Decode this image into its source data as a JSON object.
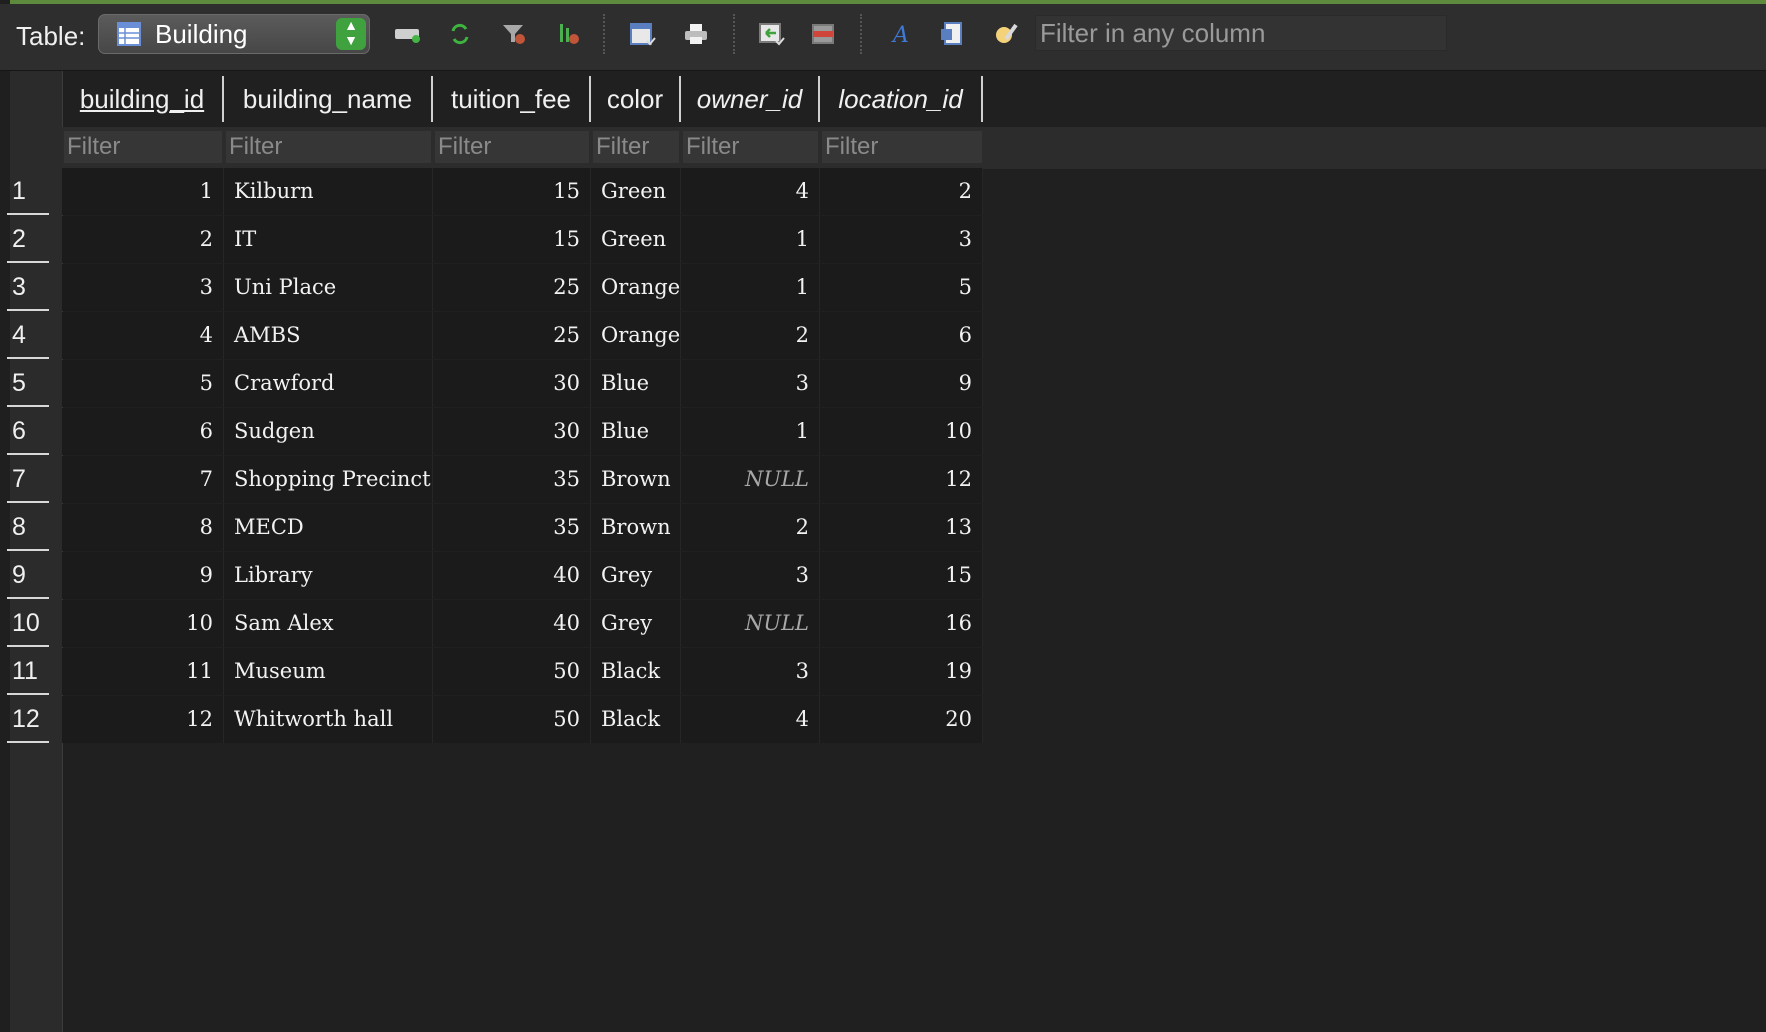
{
  "toolbar": {
    "table_label": "Table:",
    "selected_table": "Building",
    "search_placeholder": "Filter in any column",
    "buttons": [
      {
        "name": "new-record-icon"
      },
      {
        "name": "refresh-icon"
      },
      {
        "name": "clear-filters-icon"
      },
      {
        "name": "sort-icon"
      },
      {
        "name": "save-table-icon"
      },
      {
        "name": "print-icon"
      },
      {
        "name": "insert-values-icon"
      },
      {
        "name": "delete-record-icon"
      },
      {
        "name": "italic-format-icon"
      },
      {
        "name": "document-icon"
      },
      {
        "name": "edit-display-icon"
      }
    ]
  },
  "grid": {
    "columns": [
      {
        "label": "building_id",
        "kind": "pk"
      },
      {
        "label": "building_name",
        "kind": "text"
      },
      {
        "label": "tuition_fee",
        "kind": "text"
      },
      {
        "label": "color",
        "kind": "text"
      },
      {
        "label": "owner_id",
        "kind": "fk"
      },
      {
        "label": "location_id",
        "kind": "fk"
      }
    ],
    "filter_placeholder": "Filter",
    "null_text": "NULL",
    "rows": [
      {
        "num": "1",
        "cells": [
          "1",
          "Kilburn",
          "15",
          "Green",
          "4",
          "2"
        ]
      },
      {
        "num": "2",
        "cells": [
          "2",
          "IT",
          "15",
          "Green",
          "1",
          "3"
        ]
      },
      {
        "num": "3",
        "cells": [
          "3",
          "Uni Place",
          "25",
          "Orange",
          "1",
          "5"
        ]
      },
      {
        "num": "4",
        "cells": [
          "4",
          "AMBS",
          "25",
          "Orange",
          "2",
          "6"
        ]
      },
      {
        "num": "5",
        "cells": [
          "5",
          "Crawford",
          "30",
          "Blue",
          "3",
          "9"
        ]
      },
      {
        "num": "6",
        "cells": [
          "6",
          "Sudgen",
          "30",
          "Blue",
          "1",
          "10"
        ]
      },
      {
        "num": "7",
        "cells": [
          "7",
          "Shopping Precinct",
          "35",
          "Brown",
          "NULL",
          "12"
        ]
      },
      {
        "num": "8",
        "cells": [
          "8",
          "MECD",
          "35",
          "Brown",
          "2",
          "13"
        ]
      },
      {
        "num": "9",
        "cells": [
          "9",
          "Library",
          "40",
          "Grey",
          "3",
          "15"
        ]
      },
      {
        "num": "10",
        "cells": [
          "10",
          "Sam Alex",
          "40",
          "Grey",
          "NULL",
          "16"
        ]
      },
      {
        "num": "11",
        "cells": [
          "11",
          "Museum",
          "50",
          "Black",
          "3",
          "19"
        ]
      },
      {
        "num": "12",
        "cells": [
          "12",
          "Whitworth hall",
          "50",
          "Black",
          "4",
          "20"
        ]
      }
    ]
  },
  "colors": {
    "accent": "#3fa23f",
    "background": "#1f1f1f",
    "toolbar": "#2e2e2e"
  }
}
